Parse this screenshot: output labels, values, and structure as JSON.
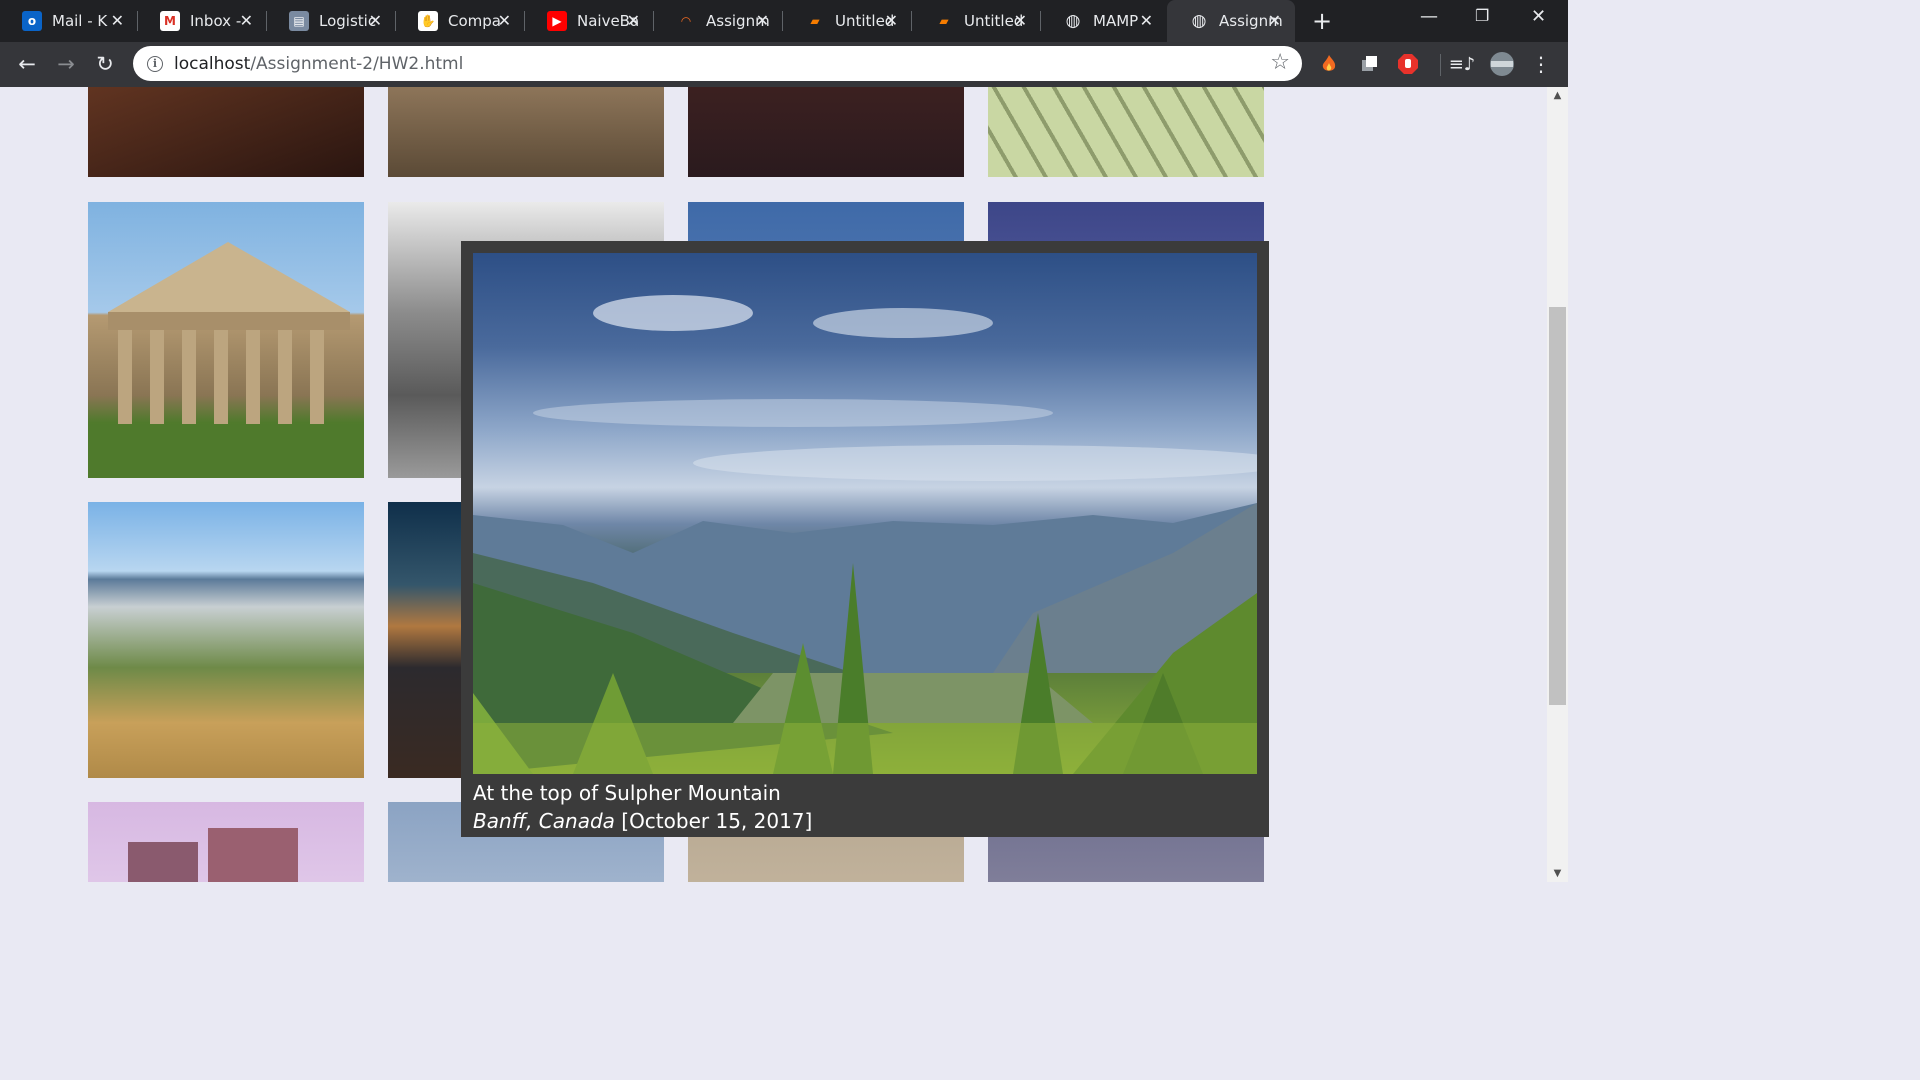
{
  "browser": {
    "tabs": [
      {
        "title": "Mail - K",
        "icon": "outlook-icon",
        "color": "#0a64c8"
      },
      {
        "title": "Inbox -",
        "icon": "gmail-icon",
        "color": "#d93025"
      },
      {
        "title": "Logistic",
        "icon": "page-icon",
        "color": "#7a8aa0"
      },
      {
        "title": "Compa",
        "icon": "hand-icon",
        "color": "#ffffff"
      },
      {
        "title": "NaiveBa",
        "icon": "youtube-icon",
        "color": "#ff0000"
      },
      {
        "title": "Assignm",
        "icon": "loader-icon",
        "color": "#f26a21"
      },
      {
        "title": "Untitled",
        "icon": "notebook-icon",
        "color": "#f57c00"
      },
      {
        "title": "Untitled",
        "icon": "notebook-icon",
        "color": "#f57c00"
      },
      {
        "title": "MAMP",
        "icon": "globe-icon",
        "color": "#e8eaed"
      },
      {
        "title": "Assignm",
        "icon": "globe-icon",
        "color": "#e8eaed"
      }
    ],
    "new_tab_label": "+",
    "url_host": "localhost",
    "url_path": "/Assignment-2/HW2.html"
  },
  "lightbox": {
    "title": "At the top of Sulpher Mountain",
    "location": "Banff, Canada",
    "date": "[October 15, 2017]"
  },
  "colors": {
    "page_background": "#e9e9f3",
    "lightbox_frame": "#3b3b3b",
    "tab_bar": "#202124",
    "toolbar": "#35363a"
  }
}
